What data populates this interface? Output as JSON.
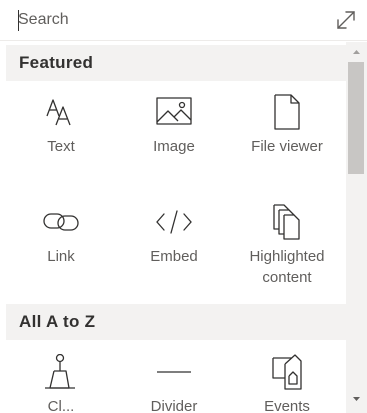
{
  "search": {
    "placeholder": "Search",
    "value": ""
  },
  "sections": [
    {
      "title": "Featured",
      "items": [
        {
          "label": "Text",
          "icon": "text-icon"
        },
        {
          "label": "Image",
          "icon": "image-icon"
        },
        {
          "label": "File viewer",
          "icon": "file-icon"
        },
        {
          "label": "Link",
          "icon": "link-icon"
        },
        {
          "label": "Embed",
          "icon": "code-icon"
        },
        {
          "label": "Highlighted content",
          "icon": "highlighted-content-icon"
        }
      ]
    },
    {
      "title": "All A to Z",
      "items": [
        {
          "label": "Cl...",
          "icon": "call-to-action-icon"
        },
        {
          "label": "Divider",
          "icon": "divider-icon"
        },
        {
          "label": "Events",
          "icon": "connector-icon"
        }
      ]
    }
  ]
}
